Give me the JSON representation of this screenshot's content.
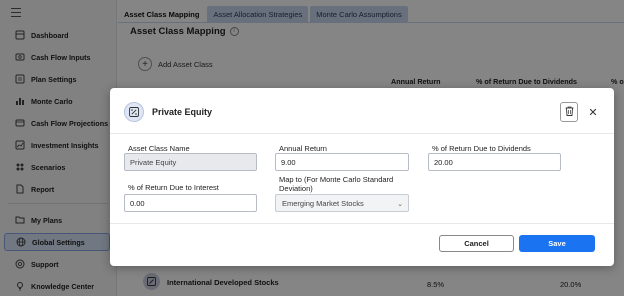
{
  "sidebar": {
    "items": [
      {
        "label": "Dashboard",
        "icon": "dashboard-icon"
      },
      {
        "label": "Cash Flow Inputs",
        "icon": "cash-flow-icon"
      },
      {
        "label": "Plan Settings",
        "icon": "plan-settings-icon"
      },
      {
        "label": "Monte Carlo",
        "icon": "bar-chart-icon"
      },
      {
        "label": "Cash Flow Projections",
        "icon": "projections-icon"
      },
      {
        "label": "Investment Insights",
        "icon": "insights-icon"
      },
      {
        "label": "Scenarios",
        "icon": "scenarios-icon"
      },
      {
        "label": "Report",
        "icon": "report-icon"
      },
      {
        "label": "My Plans",
        "icon": "folder-icon"
      },
      {
        "label": "Global Settings",
        "icon": "globe-icon",
        "active": true
      },
      {
        "label": "Support",
        "icon": "support-icon"
      },
      {
        "label": "Knowledge Center",
        "icon": "knowledge-icon"
      }
    ]
  },
  "tabs": [
    {
      "label": "Asset Class Mapping",
      "active": true
    },
    {
      "label": "Asset Allocation Strategies"
    },
    {
      "label": "Monte Carlo Assumptions"
    }
  ],
  "main": {
    "title": "Asset Class Mapping",
    "add_label": "Add Asset Class",
    "columns": [
      "Annual Return",
      "% of Return Due to Dividends",
      "% o"
    ],
    "row": {
      "name": "International Developed Stocks",
      "annual_return": "8.5%",
      "dividends": "20.0%"
    }
  },
  "modal": {
    "title": "Private Equity",
    "fields": {
      "asset_class_name": {
        "label": "Asset Class Name",
        "value": "Private Equity"
      },
      "annual_return": {
        "label": "Annual Return",
        "value": "9.00"
      },
      "dividends": {
        "label": "% of Return Due to Dividends",
        "value": "20.00"
      },
      "interest": {
        "label": "% of Return Due to Interest",
        "value": "0.00"
      },
      "map_to": {
        "label": "Map to (For Monte Carlo Standard Deviation)",
        "value": "Emerging Market Stocks"
      }
    },
    "cancel_label": "Cancel",
    "save_label": "Save"
  },
  "colors": {
    "accent": "#1a73f0",
    "overlay": "rgba(0,0,0,0.48)",
    "active_nav": "#dbe6f9"
  }
}
